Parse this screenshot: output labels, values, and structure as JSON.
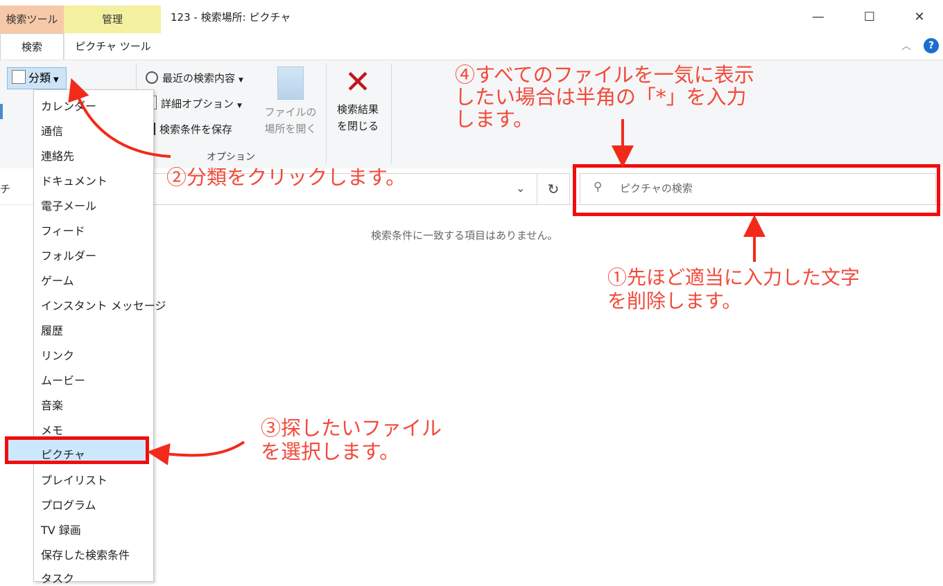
{
  "window": {
    "title": "123 - 検索場所: ピクチャ",
    "controls": {
      "minimize": "—",
      "maximize": "☐",
      "close": "✕"
    },
    "collapse_glyph": "︿",
    "help_glyph": "?"
  },
  "tabs": {
    "context_search": "検索ツール",
    "context_manage": "管理",
    "search": "検索",
    "picture_tools": "ピクチャ ツール"
  },
  "ribbon": {
    "classification": "分類",
    "recent_searches": "最近の検索内容",
    "advanced_options": "詳細オプション",
    "save_search": "検索条件を保存",
    "options_group": "オプション",
    "open_location_line1": "ファイルの",
    "open_location_line2": "場所を開く",
    "close_search_line1": "検索結果",
    "close_search_line2": "を閉じる",
    "close_glyph": "✕"
  },
  "address": {
    "nav_stub": "チ",
    "refresh_glyph": "↻",
    "chevron_glyph": "⌄"
  },
  "search": {
    "placeholder": "ピクチャの検索",
    "icon_glyph": "⚲"
  },
  "content": {
    "empty_message": "検索条件に一致する項目はありません。"
  },
  "menu": {
    "items": [
      "カレンダー",
      "通信",
      "連絡先",
      "ドキュメント",
      "電子メール",
      "フィード",
      "フォルダー",
      "ゲーム",
      "インスタント メッセージ",
      "履歴",
      "リンク",
      "ムービー",
      "音楽",
      "メモ",
      "ピクチャ",
      "プレイリスト",
      "プログラム",
      "TV 録画",
      "保存した検索条件",
      "タスク"
    ],
    "selected": "ピクチャ"
  },
  "annotations": {
    "step1_line1": "①先ほど適当に入力した文字",
    "step1_line2": "を削除します。",
    "step2": "②分類をクリックします。",
    "step3_line1": "③探したいファイル",
    "step3_line2": "を選択します。",
    "step4_line1": "④すべてのファイルを一気に表示",
    "step4_line2": "したい場合は半角の「*」を入力",
    "step4_line3": "します。",
    "color": "#f24a3a"
  }
}
